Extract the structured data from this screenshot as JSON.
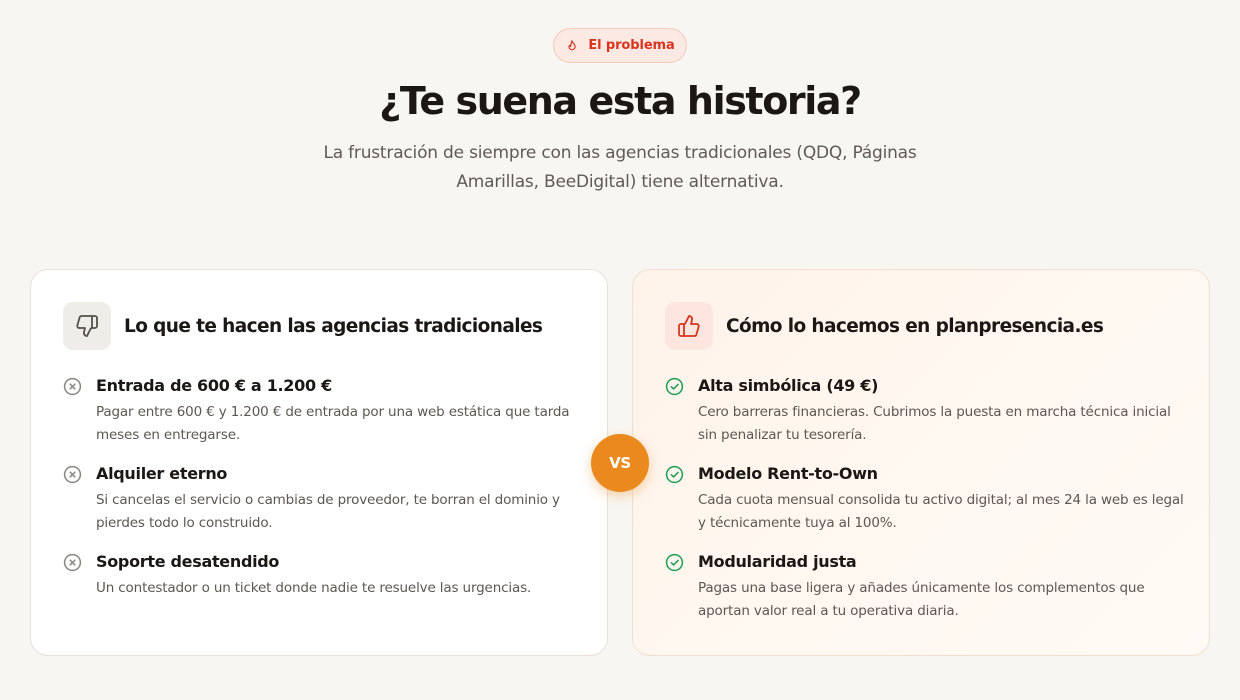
{
  "badge": {
    "label": "El problema",
    "icon": "flame-icon",
    "color": "#d8351f"
  },
  "heading": "¿Te suena esta historia?",
  "subtitle": "La frustración de siempre con las agencias tradicionales (QDQ, Páginas Amarillas, BeeDigital) tiene alternativa.",
  "vs_label": "VS",
  "left_card": {
    "title": "Lo que te hacen las agencias tradicionales",
    "icon": "thumbs-down-icon",
    "items": [
      {
        "icon": "x-circle-icon",
        "title": "Entrada de 600 € a 1.200 €",
        "desc": "Pagar entre 600 € y 1.200 € de entrada por una web estática que tarda meses en entregarse."
      },
      {
        "icon": "x-circle-icon",
        "title": "Alquiler eterno",
        "desc": "Si cancelas el servicio o cambias de proveedor, te borran el dominio y pierdes todo lo construido."
      },
      {
        "icon": "x-circle-icon",
        "title": "Soporte desatendido",
        "desc": "Un contestador o un ticket donde nadie te resuelve las urgencias."
      }
    ]
  },
  "right_card": {
    "title": "Cómo lo hacemos en planpresencia.es",
    "icon": "thumbs-up-icon",
    "items": [
      {
        "icon": "check-circle-icon",
        "title": "Alta simbólica (49 €)",
        "desc": "Cero barreras financieras. Cubrimos la puesta en marcha técnica inicial sin penalizar tu tesorería."
      },
      {
        "icon": "check-circle-icon",
        "title": "Modelo Rent-to-Own",
        "desc": "Cada cuota mensual consolida tu activo digital; al mes 24 la web es legal y técnicamente tuya al 100%."
      },
      {
        "icon": "check-circle-icon",
        "title": "Modularidad justa",
        "desc": "Pagas una base ligera y añades únicamente los complementos que aportan valor real a tu operativa diaria."
      }
    ]
  },
  "colors": {
    "accent_orange": "#ea8a1e",
    "negative_gray": "#8a857f",
    "positive_green": "#1f9d55",
    "thumbs_up_red": "#d8351f"
  }
}
